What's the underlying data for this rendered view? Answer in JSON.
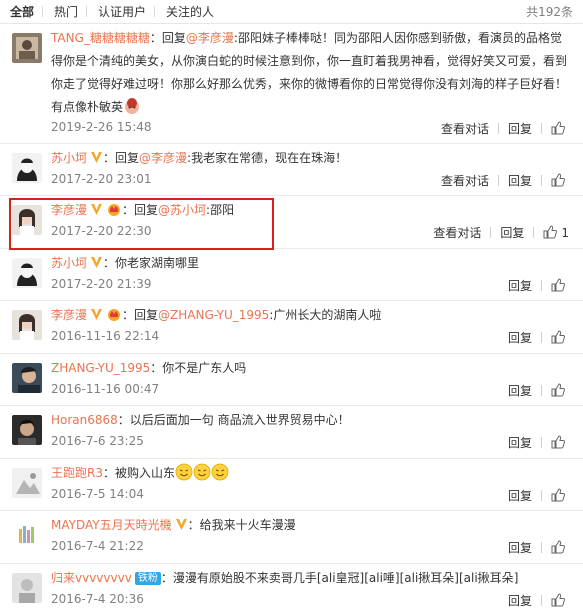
{
  "tabs": [
    {
      "label": "全部",
      "active": true
    },
    {
      "label": "热门",
      "active": false
    },
    {
      "label": "认证用户",
      "active": false
    },
    {
      "label": "关注的人",
      "active": false
    }
  ],
  "total_count": "共192条",
  "actions": {
    "view_dialog": "查看对话",
    "reply": "回复"
  },
  "comments": [
    {
      "user": "TANG_糖糖糖糖糖",
      "reply_prefix": "：回复",
      "mention": "@李彦漫",
      "text_lines": [
        ":邵阳妹子棒棒哒！同为邵阳人因你感到骄傲，看演员的品格觉",
        "得你是个清纯的美女，从你演白蛇的时候注意到你，你一直盯着我男神看，觉得好笑又可爱，看到",
        "你走了觉得好难过呀！你那么好那么优秀，来你的微博看你的日常觉得你没有刘海的样子巨好看！",
        "有点像朴敏英"
      ],
      "time": "2019-2-26 15:48",
      "like_count": ""
    },
    {
      "user": "苏小坷",
      "reply_prefix": "：回复",
      "mention": "@李彦漫",
      "text": ":我老家在常德，现在在珠海！",
      "time": "2017-2-20 23:01",
      "like_count": ""
    },
    {
      "user": "李彦漫",
      "reply_prefix": "：回复",
      "mention": "@苏小坷",
      "text": ":邵阳",
      "time": "2017-2-20 22:30",
      "like_count": "1"
    },
    {
      "user": "苏小坷",
      "text": "：你老家湖南哪里",
      "time": "2017-2-20 21:39",
      "like_count": ""
    },
    {
      "user": "李彦漫",
      "reply_prefix": "：回复",
      "mention": "@ZHANG-YU_1995",
      "text": ":广州长大的湖南人啦",
      "time": "2016-11-16 22:14",
      "like_count": ""
    },
    {
      "user": "ZHANG-YU_1995",
      "text": "：你不是广东人吗",
      "time": "2016-11-16 00:47",
      "like_count": ""
    },
    {
      "user": "Horan6868",
      "text": "：以后后面加一句 商品流入世界贸易中心！",
      "time": "2016-7-6 23:25",
      "like_count": ""
    },
    {
      "user": "王跑跑R3",
      "text": "：被购入山东",
      "time": "2016-7-5 14:04",
      "like_count": ""
    },
    {
      "user": "MAYDAY五月天時光機",
      "text": "：给我来十火车漫漫",
      "time": "2016-7-4 21:22",
      "like_count": ""
    },
    {
      "user": "归来vvvvvvvv",
      "badge": "铁粉",
      "text": "：漫漫有原始股不来卖哥几手[ali皇冠][ali唾][ali揪耳朵][ali揪耳朵]",
      "time": "2016-7-4 20:36",
      "like_count": ""
    }
  ],
  "colors": {
    "username": "#eb7350",
    "highlight_border": "#d9201c",
    "time": "#808080"
  }
}
